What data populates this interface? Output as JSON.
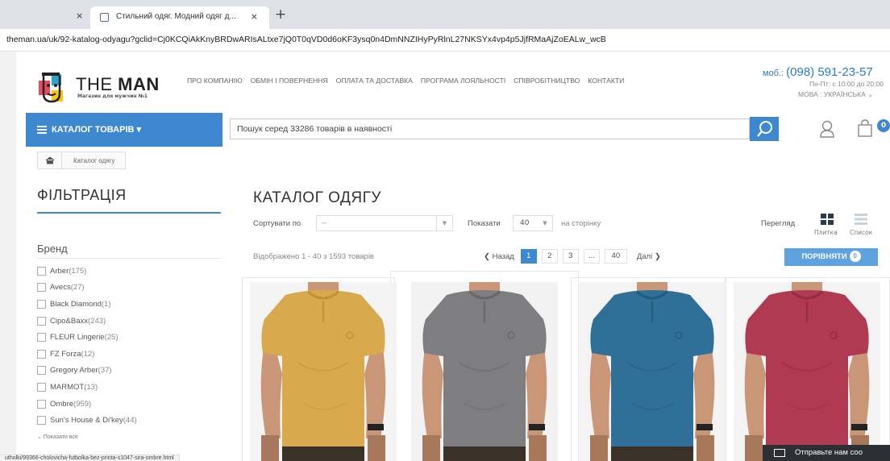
{
  "browser": {
    "tab_title": "Стильний одяг. Модний одяг д...",
    "close_glyph": "×",
    "new_tab_glyph": "+",
    "url": "theman.ua/uk/92-katalog-odyagu?gclid=Cj0KCQiAkKnyBRDwARIsALtxe7jQ0T0qVD0d6oKF3ysq0n4DmNNZIHyPyRlnL27NKSYx4vp4p5JjfRMaAjZoEALw_wcB"
  },
  "header": {
    "logo_text_light": "THE ",
    "logo_text_bold": "MAN",
    "logo_subtitle": "Магазин для мужчин №1",
    "nav": [
      "ПРО КОМПАНІЮ",
      "ОБМІН І ПОВЕРНЕННЯ",
      "ОПЛАТА ТА ДОСТАВКА",
      "ПРОГРАМА ЛОЯЛЬНОСТІ",
      "СПІВРОБІТНИЦТВО",
      "КОНТАКТИ"
    ],
    "phone_prefix": "моб.: ",
    "phone_number": "(098) 591-23-57",
    "hours": "Пн-Пт: с 10:00 до 20:00",
    "language": "МОВА : УКРАЇНСЬКА ⌄"
  },
  "catalog_bar": {
    "button_label": "КАТАЛОГ ТОВАРІВ ▾",
    "search_placeholder": "Пошук серед 33286 товарів в наявності",
    "cart_count": "0"
  },
  "breadcrumb": {
    "current": "Каталог одягу"
  },
  "filters": {
    "title": "ФІЛЬТРАЦІЯ",
    "brand_title": "Бренд",
    "brands": [
      {
        "name": "Arber",
        "count": "(175)"
      },
      {
        "name": "Avecs",
        "count": "(27)"
      },
      {
        "name": "Black Diamond",
        "count": "(1)"
      },
      {
        "name": "Cipo&Baxx",
        "count": "(243)"
      },
      {
        "name": "FLEUR Lingerie",
        "count": "(25)"
      },
      {
        "name": "FZ Forza",
        "count": "(12)"
      },
      {
        "name": "Gregory Arber",
        "count": "(37)"
      },
      {
        "name": "MARMOT",
        "count": "(13)"
      },
      {
        "name": "Ombre",
        "count": "(959)"
      },
      {
        "name": "Sun's House & Di'key",
        "count": "(44)"
      }
    ],
    "show_all": "⌄ Показати все"
  },
  "catalog": {
    "title": "КАТАЛОГ ОДЯГУ",
    "sort_label": "Сортувати по",
    "sort_value": "--",
    "show_label": "Показати",
    "show_value": "40",
    "per_page": "на сторінку",
    "view_label": "Перегляд",
    "view_grid": "Плитка",
    "view_list": "Список",
    "shown_text": "Відображено 1 - 40 з 1593 товарів",
    "pager": {
      "prev": "❮ Назад",
      "pages": [
        "1",
        "2",
        "3",
        "...",
        "40"
      ],
      "next": "Далі ❯"
    },
    "compare_label": "ПОРІВНЯТИ",
    "compare_count": "0"
  },
  "products": [
    {
      "color_name": "mustard",
      "shirt": "#d9a94d",
      "shade": "#c0913a",
      "bg": "#f4f4f4"
    },
    {
      "color_name": "grey",
      "shirt": "#7e7e80",
      "shade": "#676769",
      "bg": "#f2f2f2"
    },
    {
      "color_name": "blue",
      "shirt": "#2f6f98",
      "shade": "#245a7d",
      "bg": "#f3f3f3"
    },
    {
      "color_name": "burgundy",
      "shirt": "#b03a52",
      "shade": "#922d43",
      "bg": "#f3f3f3"
    }
  ],
  "status_url": "utholki/99366-cholovicha-futbolka-bez-printa-s1047-sira-ombre.html",
  "chat_text": "Отправьте нам соо",
  "colors": {
    "accent": "#3d88cf"
  }
}
